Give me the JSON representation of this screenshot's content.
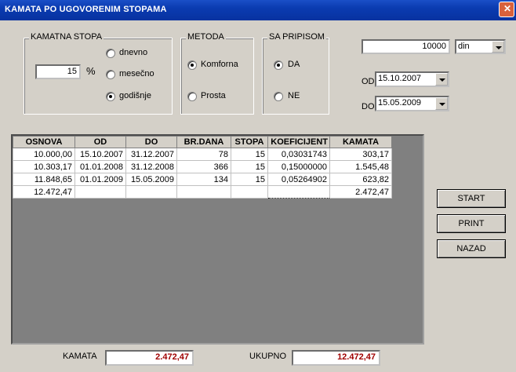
{
  "window": {
    "title": "KAMATA PO UGOVORENIM STOPAMA"
  },
  "kamatna_stopa": {
    "legend": "KAMATNA STOPA",
    "value": "15",
    "unit": "%",
    "options": [
      "dnevno",
      "mesečno",
      "godišnje"
    ],
    "selected": "godišnje"
  },
  "metoda": {
    "legend": "METODA",
    "options": [
      "Komforna",
      "Prosta"
    ],
    "selected": "Komforna"
  },
  "sa_pripisom": {
    "legend": "SA PRIPISOM",
    "options": [
      "DA",
      "NE"
    ],
    "selected": "DA"
  },
  "amount": {
    "value": "10000",
    "currency": "din"
  },
  "dates": {
    "od_label": "OD",
    "od_value": "15.10.2007",
    "do_label": "DO",
    "do_value": "15.05.2009"
  },
  "table": {
    "headers": [
      "OSNOVA",
      "OD",
      "DO",
      "BR.DANA",
      "STOPA",
      "KOEFICIJENT",
      "KAMATA"
    ],
    "rows": [
      [
        "10.000,00",
        "15.10.2007",
        "31.12.2007",
        "78",
        "15",
        "0,03031743",
        "303,17"
      ],
      [
        "10.303,17",
        "01.01.2008",
        "31.12.2008",
        "366",
        "15",
        "0,15000000",
        "1.545,48"
      ],
      [
        "11.848,65",
        "01.01.2009",
        "15.05.2009",
        "134",
        "15",
        "0,05264902",
        "623,82"
      ],
      [
        "12.472,47",
        "",
        "",
        "",
        "",
        "",
        "2.472,47"
      ]
    ]
  },
  "buttons": {
    "start": "START",
    "print": "PRINT",
    "nazad": "NAZAD"
  },
  "footer": {
    "kamata_label": "KAMATA",
    "kamata_value": "2.472,47",
    "ukupno_label": "UKUPNO",
    "ukupno_value": "12.472,47"
  }
}
